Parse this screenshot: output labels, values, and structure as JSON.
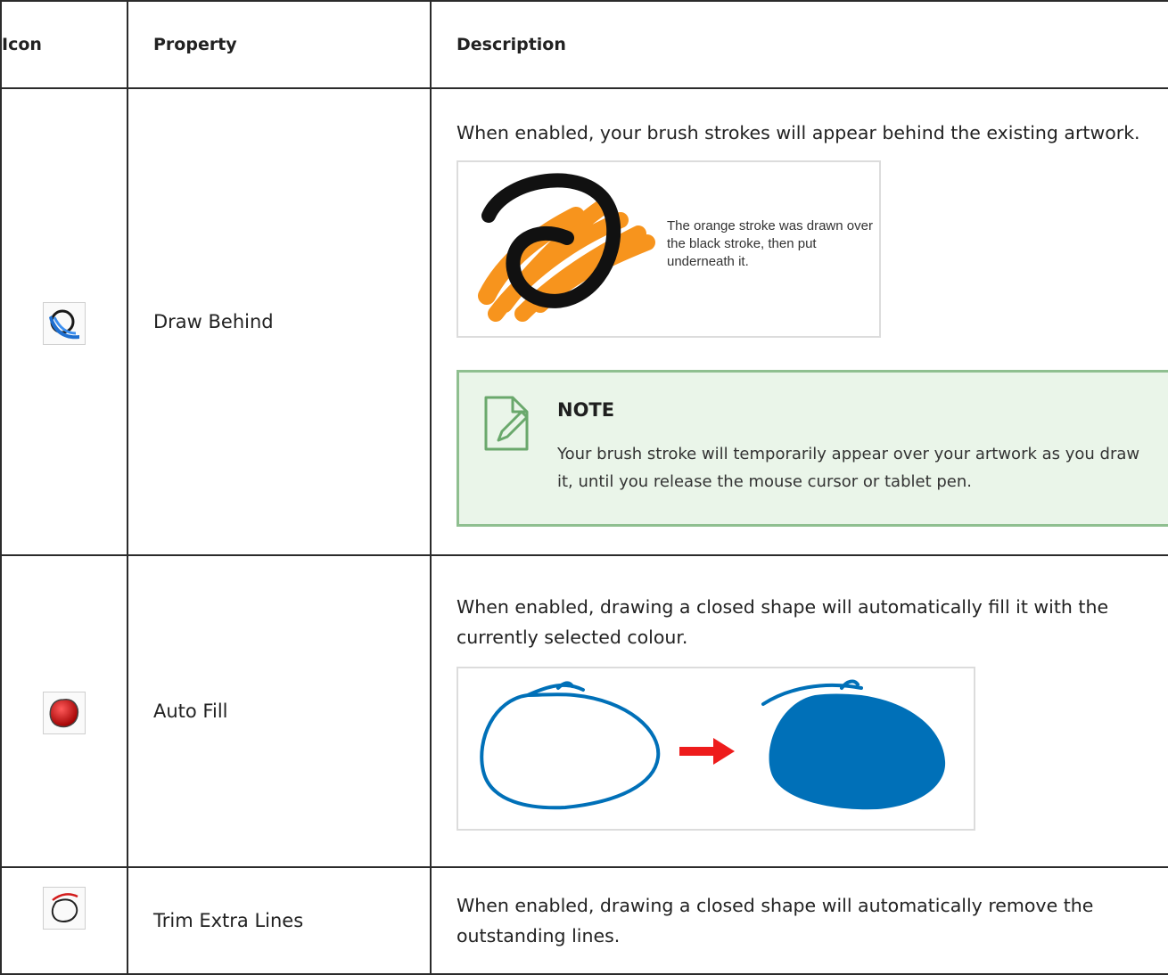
{
  "table": {
    "headers": {
      "icon": "Icon",
      "property": "Property",
      "description": "Description"
    },
    "rows": [
      {
        "icon": "draw-behind-icon",
        "property": "Draw Behind",
        "description": "When enabled, your brush strokes will appear behind the existing artwork.",
        "figure_caption": "The orange stroke was drawn over the black stroke, then put underneath it.",
        "note": {
          "title": "NOTE",
          "text": "Your brush stroke will temporarily appear over your artwork as you draw it, until you release the mouse cursor or tablet pen."
        }
      },
      {
        "icon": "auto-fill-icon",
        "property": "Auto Fill",
        "description": "When enabled, drawing a closed shape will automatically fill it with the currently selected colour."
      },
      {
        "icon": "trim-extra-lines-icon",
        "property": "Trim Extra Lines",
        "description": "When enabled, drawing a closed shape will automatically remove the outstanding lines."
      }
    ]
  },
  "colors": {
    "note_background": "#eaf5e9",
    "note_border": "#8fbf90",
    "orange_stroke": "#f7941d",
    "blue_stroke": "#0070b8",
    "arrow_red": "#ee1c1c"
  }
}
